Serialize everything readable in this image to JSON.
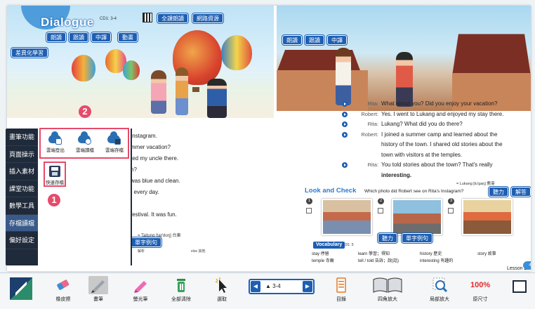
{
  "header": {
    "title": "Dialogue",
    "cd_label": "CD1: 3-4",
    "buttons_top": [
      "全課朗讀",
      "網路資源"
    ],
    "buttons_left": [
      "朗讀",
      "跟讀",
      "中譯",
      "動畫"
    ],
    "diff_button": "差異化學習",
    "buttons_right": [
      "朗讀",
      "跟讀",
      "中譯"
    ]
  },
  "dialog_left": [
    "Instagram.",
    "mmer vacation?",
    "ted my uncle there.",
    "h?",
    "was blue and clean.",
    "t every day.",
    "",
    "festival. It was fun."
  ],
  "dialog_right": [
    {
      "speaker": "Rita:",
      "text": "What about you? Did you enjoy your vacation?"
    },
    {
      "speaker": "Robert:",
      "text": "Yes. I went to Lukang and enjoyed my stay there."
    },
    {
      "speaker": "Rita:",
      "text": "Lukang? What did you do there?"
    },
    {
      "speaker": "Robert:",
      "text": "I joined a summer camp and learned about the"
    },
    {
      "speaker": "",
      "text": "history of the town. I shared old stories about the"
    },
    {
      "speaker": "",
      "text": "town with visitors at the temples."
    },
    {
      "speaker": "Rita:",
      "text": "You told stories about the town? That's really"
    },
    {
      "speaker": "",
      "text": "interesting."
    }
  ],
  "pron_note": "= Lukang [lu'gaŋ] 鹿港",
  "look_check": {
    "title": "Look and Check",
    "question": "Which photo did Robert see on Rita's Instagram?",
    "listen_btn": "聽力",
    "answer_btn": "解答",
    "numbers": [
      "1",
      "2",
      "3"
    ]
  },
  "taitung_note": "= Taitung [taɪ'dʊŋ] 台東",
  "example_btn_left": "單字例句",
  "vocab": {
    "tab": "Vocabulary",
    "cd": "CD1: 5",
    "listen_btn": "聽力",
    "example_btn": "單字例句",
    "words": [
      {
        "w": "stay 停留"
      },
      {
        "w": "learn 學習；得知"
      },
      {
        "w": "history 歷史"
      },
      {
        "w": "story 故事"
      },
      {
        "w": "temple 寺廟"
      },
      {
        "w": "tell / told 告訴；說(話)"
      },
      {
        "w": "interesting 有趣的"
      }
    ],
    "left_col": [
      "解析",
      "else 其他"
    ]
  },
  "lesson": {
    "label": "Lesson",
    "num": "1",
    "page": "4"
  },
  "sidebar": {
    "items": [
      "畫筆功能",
      "頁面操示",
      "插入素材",
      "課堂功能",
      "數學工具",
      "存檔讀檔",
      "偏好設定"
    ],
    "active_index": 5
  },
  "popup": {
    "items": [
      "雲端登出",
      "雲端讀檔",
      "雲端存檔"
    ],
    "quick_save": "快速存檔",
    "badge1": "1",
    "badge2": "2"
  },
  "toolbar": {
    "items": [
      {
        "label": "橡皮擦",
        "icon": "eraser-icon"
      },
      {
        "label": "畫筆",
        "icon": "pen-icon"
      },
      {
        "label": "螢光筆",
        "icon": "highlighter-icon"
      },
      {
        "label": "全部清除",
        "icon": "trash-icon"
      },
      {
        "label": "選取",
        "icon": "select-icon"
      },
      {
        "label": "目錄",
        "icon": "toc-icon"
      },
      {
        "label": "四角放大",
        "icon": "book-zoom-icon"
      },
      {
        "label": "局部放大",
        "icon": "magnify-icon"
      },
      {
        "label": "原尺寸",
        "icon": "original-size-icon"
      }
    ],
    "page_value": "3-4",
    "zoom": "100%",
    "active_index": 1
  },
  "colors": {
    "accent": "#1d5fb3",
    "highlight": "#e64b6a",
    "sidebar": "#1f2a3a"
  }
}
